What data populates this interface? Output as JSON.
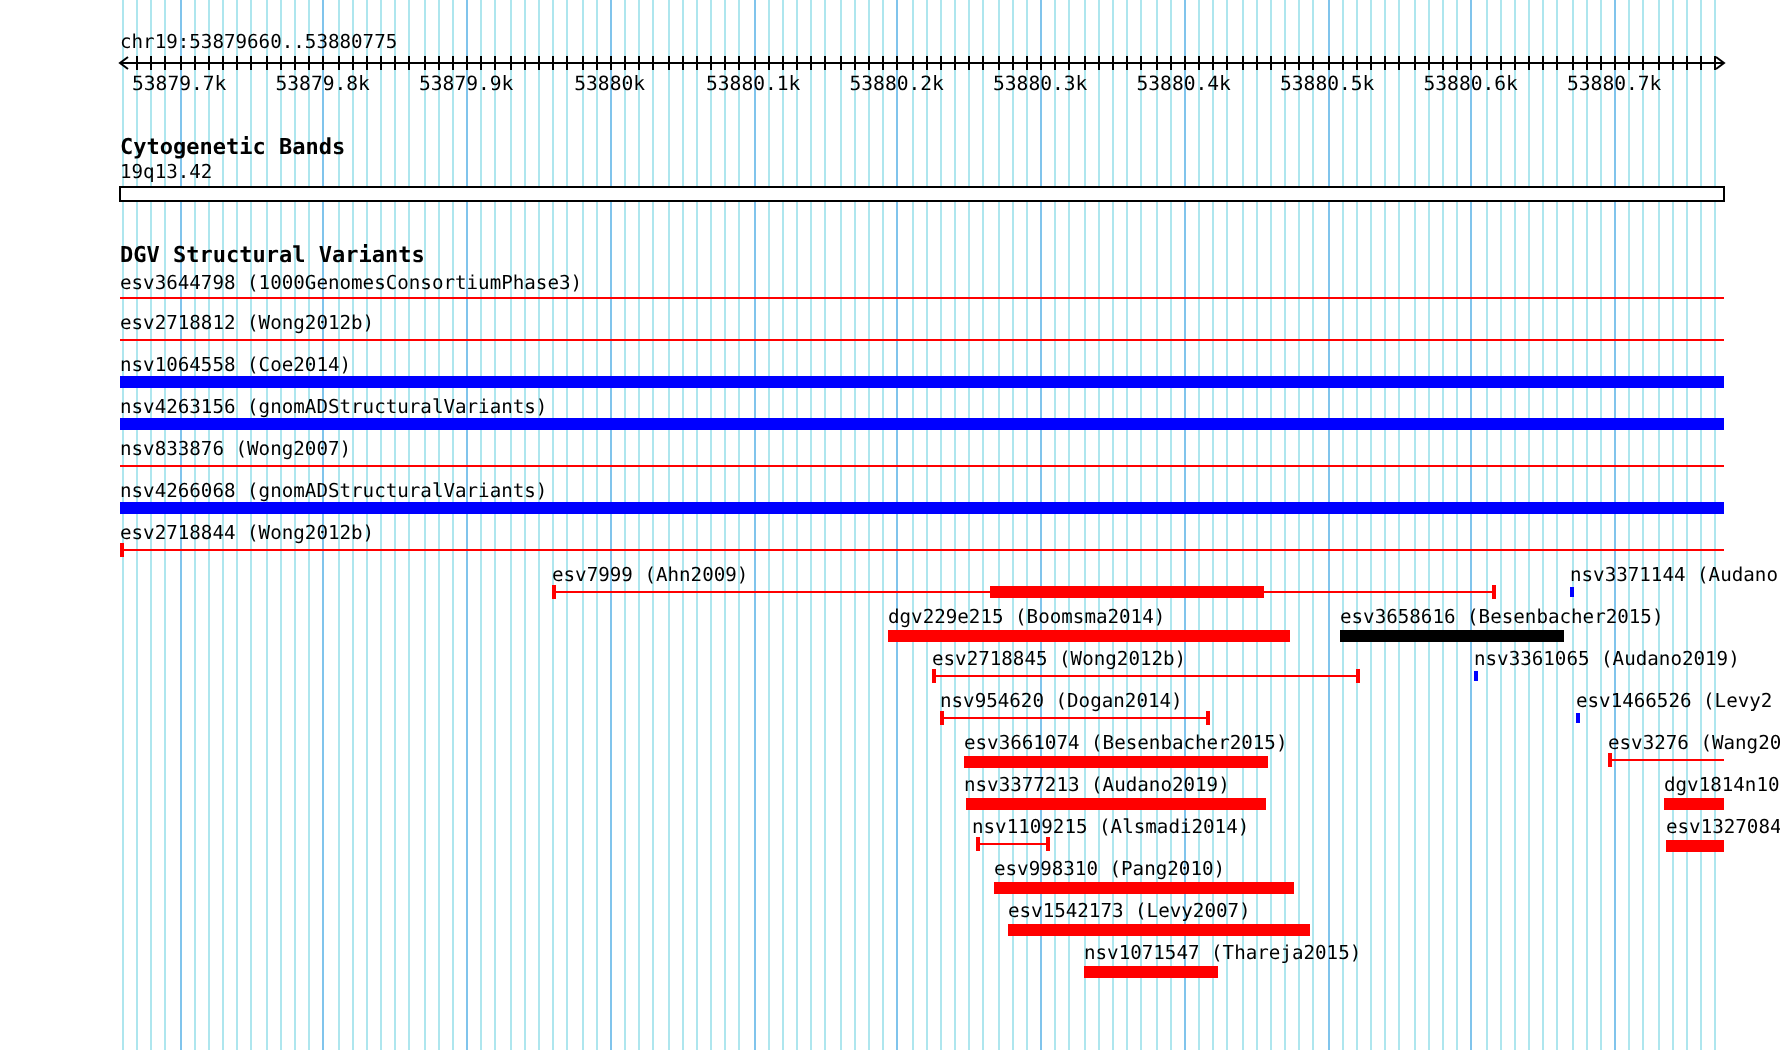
{
  "location": "chr19:53879660..53880775",
  "ruler": {
    "ticks": [
      "53879.7k",
      "53879.8k",
      "53879.9k",
      "53880k",
      "53880.1k",
      "53880.2k",
      "53880.3k",
      "53880.4k",
      "53880.5k",
      "53880.6k",
      "53880.7k"
    ]
  },
  "tracks": [
    {
      "title": "Cytogenetic Bands",
      "features": [
        {
          "label": "19q13.42",
          "kind": "band"
        }
      ]
    },
    {
      "title": "DGV Structural Variants",
      "features": [
        {
          "label": "esv3644798 (1000GenomesConsortiumPhase3)",
          "kind": "line",
          "color": "#ff0000"
        },
        {
          "label": "esv2718812 (Wong2012b)",
          "kind": "line",
          "color": "#ff0000"
        },
        {
          "label": "nsv1064558 (Coe2014)",
          "kind": "bar",
          "color": "#0000ff"
        },
        {
          "label": "nsv4263156 (gnomADStructuralVariants)",
          "kind": "bar",
          "color": "#0000ff"
        },
        {
          "label": "nsv833876 (Wong2007)",
          "kind": "line",
          "color": "#ff0000"
        },
        {
          "label": "nsv4266068 (gnomADStructuralVariants)",
          "kind": "bar",
          "color": "#0000ff"
        },
        {
          "label": "esv2718844 (Wong2012b)",
          "kind": "line",
          "color": "#ff0000"
        },
        {
          "label": "esv7999 (Ahn2009)",
          "kind": "compound",
          "color": "#ff0000"
        },
        {
          "label": "nsv3371144 (Audano",
          "kind": "bar",
          "color": "#0000ff"
        },
        {
          "label": "dgv229e215 (Boomsma2014)",
          "kind": "bar",
          "color": "#ff0000"
        },
        {
          "label": "esv3658616 (Besenbacher2015)",
          "kind": "bar",
          "color": "#000000"
        },
        {
          "label": "esv2718845 (Wong2012b)",
          "kind": "line",
          "color": "#ff0000"
        },
        {
          "label": "nsv3361065 (Audano2019)",
          "kind": "bar",
          "color": "#0000ff"
        },
        {
          "label": "nsv954620 (Dogan2014)",
          "kind": "line",
          "color": "#ff0000"
        },
        {
          "label": "esv1466526 (Levy2",
          "kind": "bar",
          "color": "#0000ff"
        },
        {
          "label": "esv3661074 (Besenbacher2015)",
          "kind": "bar",
          "color": "#ff0000"
        },
        {
          "label": "esv3276 (Wang20",
          "kind": "line",
          "color": "#ff0000"
        },
        {
          "label": "nsv3377213 (Audano2019)",
          "kind": "bar",
          "color": "#ff0000"
        },
        {
          "label": "dgv1814n10",
          "kind": "bar",
          "color": "#ff0000"
        },
        {
          "label": "nsv1109215 (Alsmadi2014)",
          "kind": "line",
          "color": "#ff0000"
        },
        {
          "label": "esv1327084",
          "kind": "bar",
          "color": "#ff0000"
        },
        {
          "label": "esv998310 (Pang2010)",
          "kind": "bar",
          "color": "#ff0000"
        },
        {
          "label": "esv1542173 (Levy2007)",
          "kind": "bar",
          "color": "#ff0000"
        },
        {
          "label": "nsv1071547 (Thareja2015)",
          "kind": "bar",
          "color": "#ff0000"
        }
      ]
    }
  ]
}
